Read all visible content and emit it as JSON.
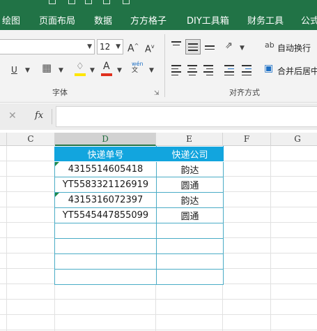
{
  "ribbon_tabs": [
    "绘图",
    "页面布局",
    "数据",
    "方方格子",
    "DIY工具箱",
    "财务工具",
    "公式"
  ],
  "font_group": {
    "label": "字体",
    "font_size": "12",
    "font_color": "#e0301e",
    "highlight_color": "#ffe600"
  },
  "align_group": {
    "label": "对齐方式",
    "wrap_text": "自动换行",
    "merge_center": "合并后居中"
  },
  "formula_bar": {
    "fx_label": "fx",
    "value": ""
  },
  "columns": [
    "C",
    "D",
    "E",
    "F",
    "G"
  ],
  "active_column": "D",
  "table": {
    "headers": [
      "快递单号",
      "快递公司"
    ],
    "rows": [
      {
        "tracking": "4315514605418",
        "company": "韵达",
        "text_flag": true
      },
      {
        "tracking": "YT5583321126919",
        "company": "圆通",
        "text_flag": false
      },
      {
        "tracking": "4315316072397",
        "company": "韵达",
        "text_flag": true
      },
      {
        "tracking": "YT5545447855099",
        "company": "圆通",
        "text_flag": false
      },
      {
        "tracking": "",
        "company": "",
        "text_flag": false
      },
      {
        "tracking": "",
        "company": "",
        "text_flag": false
      },
      {
        "tracking": "",
        "company": "",
        "text_flag": false
      },
      {
        "tracking": "",
        "company": "",
        "text_flag": false
      }
    ],
    "header_color": "#12a5de",
    "border_color": "#4aacc6"
  }
}
